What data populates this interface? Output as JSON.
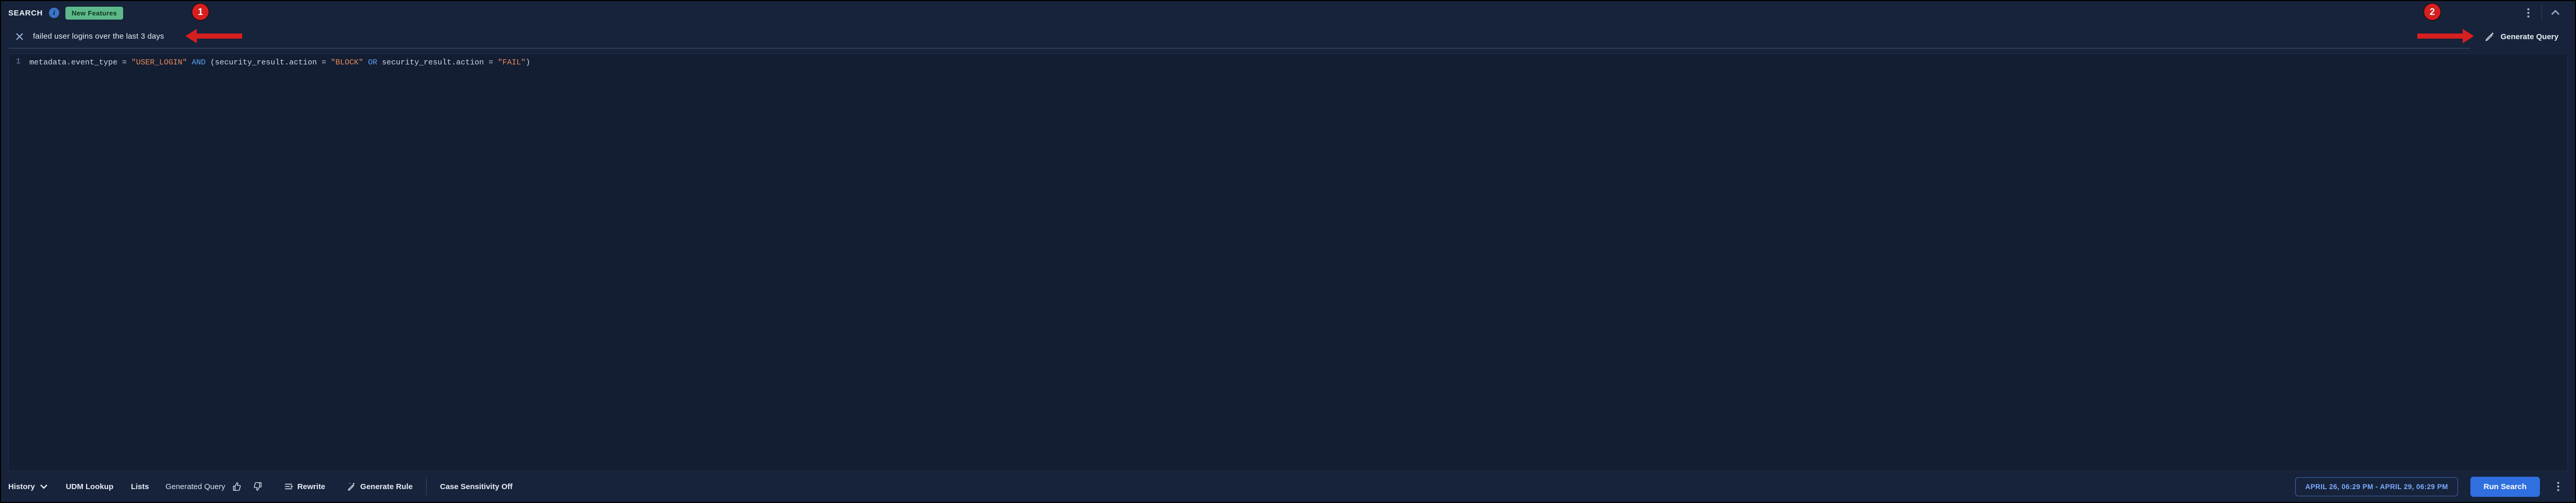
{
  "header": {
    "title": "SEARCH",
    "info_icon": "i",
    "new_features_label": "New Features"
  },
  "annotations": {
    "badge1": "1",
    "badge2": "2"
  },
  "nl_search": {
    "text": "failed user logins over the last 3 days",
    "generate_label": "Generate Query"
  },
  "code": {
    "line_numbers": [
      "1"
    ],
    "tokens": [
      {
        "t": "default",
        "v": "metadata.event_type "
      },
      {
        "t": "op",
        "v": "= "
      },
      {
        "t": "string",
        "v": "\"USER_LOGIN\""
      },
      {
        "t": "default",
        "v": " "
      },
      {
        "t": "kw",
        "v": "AND"
      },
      {
        "t": "default",
        "v": " (security_result.action "
      },
      {
        "t": "op",
        "v": "= "
      },
      {
        "t": "string",
        "v": "\"BLOCK\""
      },
      {
        "t": "default",
        "v": " "
      },
      {
        "t": "kw",
        "v": "OR"
      },
      {
        "t": "default",
        "v": " security_result.action "
      },
      {
        "t": "op",
        "v": "= "
      },
      {
        "t": "string",
        "v": "\"FAIL\""
      },
      {
        "t": "default",
        "v": ")"
      }
    ]
  },
  "toolbar": {
    "history_label": "History",
    "udm_lookup_label": "UDM Lookup",
    "lists_label": "Lists",
    "generated_query_label": "Generated Query",
    "rewrite_label": "Rewrite",
    "generate_rule_label": "Generate Rule",
    "case_sensitivity_label": "Case Sensitivity Off",
    "date_range_label": "APRIL 26, 06:29 PM - APRIL 29, 06:29 PM",
    "run_label": "Run Search"
  }
}
